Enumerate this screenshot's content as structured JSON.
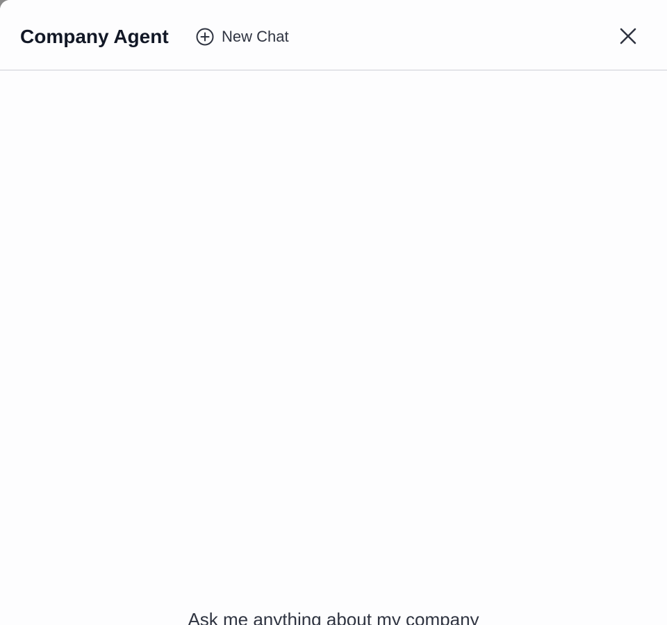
{
  "header": {
    "title": "Company Agent",
    "new_chat_label": "New Chat",
    "new_chat_icon": "plus-circle-icon",
    "close_icon": "close-icon"
  },
  "main": {
    "empty_state_text": "Ask me anything about my company"
  },
  "colors": {
    "panel_background": "#fdfdfe",
    "title_text": "#121826",
    "secondary_text": "#2f3441",
    "divider": "#e3e4e8"
  }
}
